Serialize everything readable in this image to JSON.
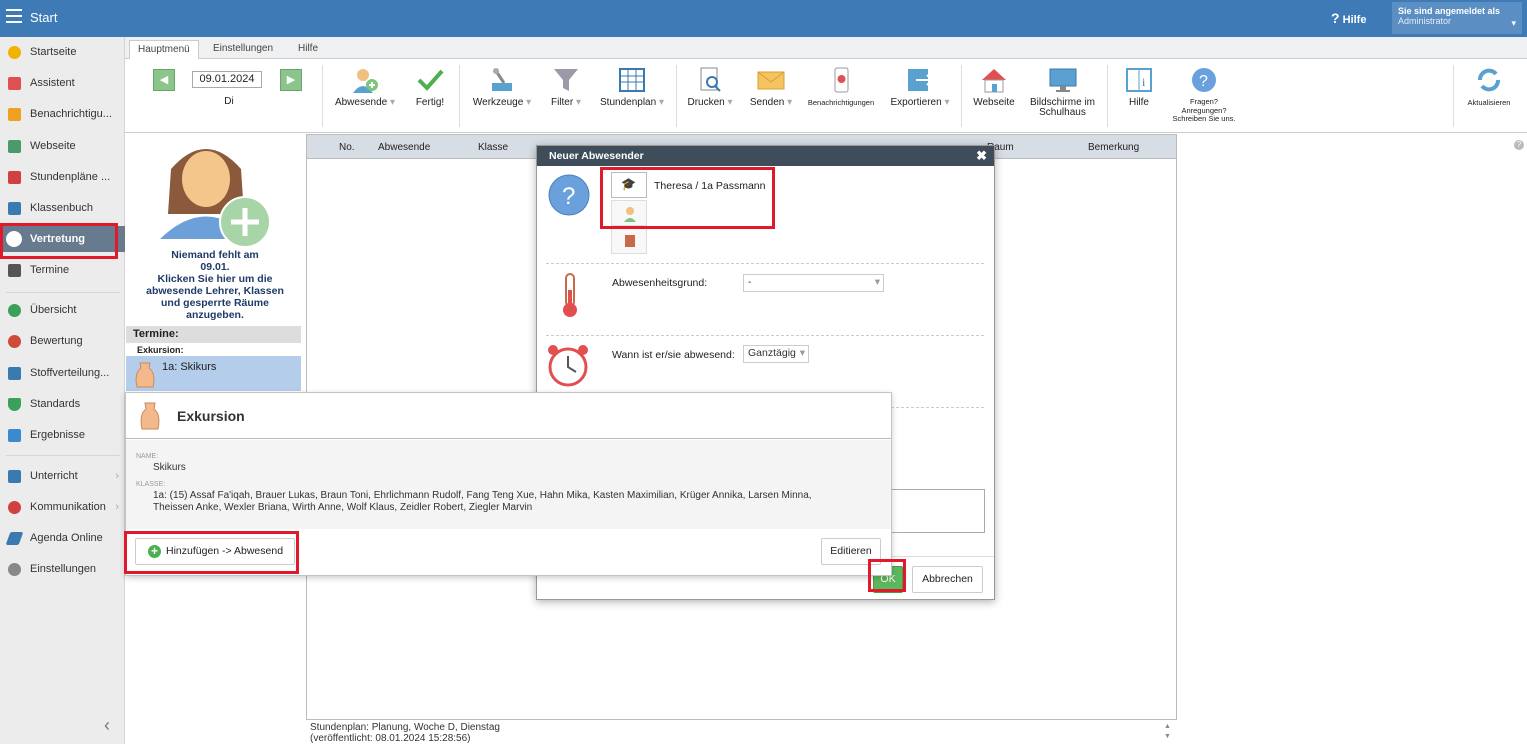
{
  "topbar": {
    "title": "Start",
    "help": "Hilfe",
    "login_line1": "Sie sind angemeldet als",
    "login_user": "Administrator"
  },
  "sidebar": {
    "items": [
      {
        "label": "Startseite",
        "color": "#f0b400"
      },
      {
        "label": "Assistent",
        "color": "#e05050"
      },
      {
        "label": "Benachrichtigu...",
        "color": "#f0a020"
      },
      {
        "label": "Webseite",
        "color": "#4a9a6a"
      },
      {
        "label": "Stundenpläne ...",
        "color": "#d04040"
      },
      {
        "label": "Klassenbuch",
        "color": "#3a7ab0"
      },
      {
        "label": "Vertretung",
        "color": "#ffffff"
      },
      {
        "label": "Termine",
        "color": "#555555"
      },
      {
        "label": "Übersicht",
        "color": "#3aa05a"
      },
      {
        "label": "Bewertung",
        "color": "#d04a3a"
      },
      {
        "label": "Stoffverteilung...",
        "color": "#3a7ab0"
      },
      {
        "label": "Standards",
        "color": "#3aa05a"
      },
      {
        "label": "Ergebnisse",
        "color": "#3a8ad0"
      },
      {
        "label": "Unterricht",
        "color": "#3a7ab0"
      },
      {
        "label": "Kommunikation",
        "color": "#d04040"
      },
      {
        "label": "Agenda Online",
        "color": "#3a7ab0"
      },
      {
        "label": "Einstellungen",
        "color": "#888888"
      }
    ]
  },
  "tabs": [
    "Hauptmenü",
    "Einstellungen",
    "Hilfe"
  ],
  "ribbon": {
    "date": "09.01.2024",
    "day": "Di",
    "absent": "Abwesende",
    "done": "Fertig!",
    "tools": "Werkzeuge",
    "filter": "Filter",
    "timetable": "Stundenplan",
    "print": "Drucken",
    "send": "Senden",
    "notifications": "Benachrichtigungen",
    "export": "Exportieren",
    "website": "Webseite",
    "screens_l1": "Bildschirme im",
    "screens_l2": "Schulhaus",
    "help": "Hilfe",
    "q1": "Fragen?",
    "q2": "Anregungen?",
    "q3": "Schreiben Sie uns.",
    "refresh": "Aktualisieren"
  },
  "left": {
    "nobody_l1": "Niemand fehlt am",
    "nobody_l2": "09.01.",
    "nobody_l3": "Klicken Sie hier um die",
    "nobody_l4": "abwesende Lehrer, Klassen",
    "nobody_l5": "und gesperrte Räume",
    "nobody_l6": "anzugeben.",
    "termine": "Termine:",
    "exkursion_label": "Exkursion:",
    "exkursion_item": "1a: Skikurs"
  },
  "grid": {
    "headers": [
      "No.",
      "Abwesende",
      "Klasse",
      "Raum",
      "Bemerkung"
    ]
  },
  "footer": {
    "line1": "Stundenplan: Planung, Woche D, Dienstag",
    "line2": "(veröffentlicht: 08.01.2024 15:28:56)"
  },
  "dialog": {
    "title": "Neuer Abwesender",
    "person": "Theresa / 1a Passmann",
    "reason_label": "Abwesenheitsgrund:",
    "reason_value": "-",
    "when_label": "Wann ist er/sie abwesend:",
    "when_value": "Ganztägig",
    "ok": "OK",
    "cancel": "Abbrechen"
  },
  "popup": {
    "title": "Exkursion",
    "name_caption": "NAME:",
    "name_value": "Skikurs",
    "class_caption": "KLASSE:",
    "class_line1": "1a: (15) Assaf Fa'iqah, Brauer Lukas, Braun Toni, Ehrlichmann Rudolf, Fang Teng Xue, Hahn Mika, Kasten Maximilian, Krüger Annika, Larsen Minna,",
    "class_line2": "Theissen Anke, Wexler Briana, Wirth Anne, Wolf Klaus, Zeidler Robert, Ziegler Marvin",
    "add_button": "Hinzufügen -> Abwesend",
    "edit_button": "Editieren"
  }
}
